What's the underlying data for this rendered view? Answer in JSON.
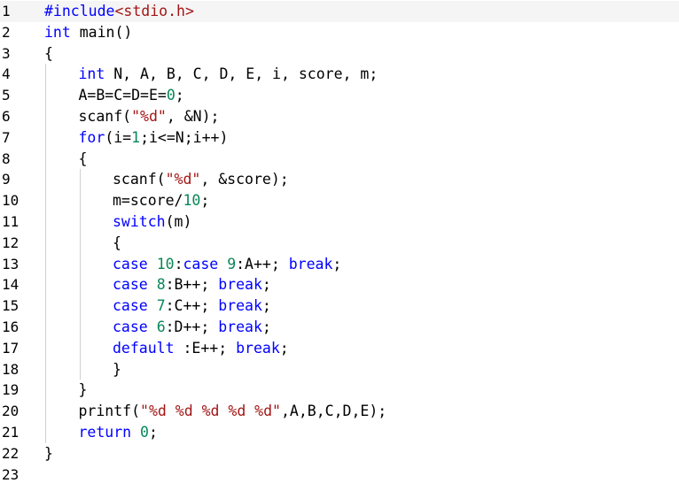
{
  "editor": {
    "lines": [
      {
        "num": "1",
        "indent": 0,
        "tokens": [
          {
            "t": "#include",
            "c": "pre"
          },
          {
            "t": "<stdio.h>",
            "c": "hdr"
          }
        ]
      },
      {
        "num": "2",
        "indent": 0,
        "tokens": [
          {
            "t": "int",
            "c": "kw"
          },
          {
            "t": " main()",
            "c": "txt"
          }
        ]
      },
      {
        "num": "3",
        "indent": 0,
        "tokens": [
          {
            "t": "{",
            "c": "txt"
          }
        ]
      },
      {
        "num": "4",
        "indent": 1,
        "tokens": [
          {
            "t": "int",
            "c": "kw"
          },
          {
            "t": " N, A, B, C, D, E, i, score, m;",
            "c": "txt"
          }
        ]
      },
      {
        "num": "5",
        "indent": 1,
        "tokens": [
          {
            "t": "A=B=C=D=E=",
            "c": "txt"
          },
          {
            "t": "0",
            "c": "num"
          },
          {
            "t": ";",
            "c": "txt"
          }
        ]
      },
      {
        "num": "6",
        "indent": 1,
        "tokens": [
          {
            "t": "scanf(",
            "c": "txt"
          },
          {
            "t": "\"%d\"",
            "c": "str"
          },
          {
            "t": ", &N);",
            "c": "txt"
          }
        ]
      },
      {
        "num": "7",
        "indent": 1,
        "tokens": [
          {
            "t": "for",
            "c": "kw"
          },
          {
            "t": "(i=",
            "c": "txt"
          },
          {
            "t": "1",
            "c": "num"
          },
          {
            "t": ";i<=N;i++)",
            "c": "txt"
          }
        ]
      },
      {
        "num": "8",
        "indent": 1,
        "tokens": [
          {
            "t": "{",
            "c": "txt"
          }
        ]
      },
      {
        "num": "9",
        "indent": 2,
        "tokens": [
          {
            "t": "scanf(",
            "c": "txt"
          },
          {
            "t": "\"%d\"",
            "c": "str"
          },
          {
            "t": ", &score);",
            "c": "txt"
          }
        ]
      },
      {
        "num": "10",
        "indent": 2,
        "tokens": [
          {
            "t": "m=score/",
            "c": "txt"
          },
          {
            "t": "10",
            "c": "num"
          },
          {
            "t": ";",
            "c": "txt"
          }
        ]
      },
      {
        "num": "11",
        "indent": 2,
        "tokens": [
          {
            "t": "switch",
            "c": "kw"
          },
          {
            "t": "(m)",
            "c": "txt"
          }
        ]
      },
      {
        "num": "12",
        "indent": 2,
        "tokens": [
          {
            "t": "{",
            "c": "txt"
          }
        ]
      },
      {
        "num": "13",
        "indent": 2,
        "tokens": [
          {
            "t": "case",
            "c": "kw"
          },
          {
            "t": " ",
            "c": "txt"
          },
          {
            "t": "10",
            "c": "num"
          },
          {
            "t": ":",
            "c": "txt"
          },
          {
            "t": "case",
            "c": "kw"
          },
          {
            "t": " ",
            "c": "txt"
          },
          {
            "t": "9",
            "c": "num"
          },
          {
            "t": ":A++; ",
            "c": "txt"
          },
          {
            "t": "break",
            "c": "kw"
          },
          {
            "t": ";",
            "c": "txt"
          }
        ]
      },
      {
        "num": "14",
        "indent": 2,
        "tokens": [
          {
            "t": "case",
            "c": "kw"
          },
          {
            "t": " ",
            "c": "txt"
          },
          {
            "t": "8",
            "c": "num"
          },
          {
            "t": ":B++; ",
            "c": "txt"
          },
          {
            "t": "break",
            "c": "kw"
          },
          {
            "t": ";",
            "c": "txt"
          }
        ]
      },
      {
        "num": "15",
        "indent": 2,
        "tokens": [
          {
            "t": "case",
            "c": "kw"
          },
          {
            "t": " ",
            "c": "txt"
          },
          {
            "t": "7",
            "c": "num"
          },
          {
            "t": ":C++; ",
            "c": "txt"
          },
          {
            "t": "break",
            "c": "kw"
          },
          {
            "t": ";",
            "c": "txt"
          }
        ]
      },
      {
        "num": "16",
        "indent": 2,
        "tokens": [
          {
            "t": "case",
            "c": "kw"
          },
          {
            "t": " ",
            "c": "txt"
          },
          {
            "t": "6",
            "c": "num"
          },
          {
            "t": ":D++; ",
            "c": "txt"
          },
          {
            "t": "break",
            "c": "kw"
          },
          {
            "t": ";",
            "c": "txt"
          }
        ]
      },
      {
        "num": "17",
        "indent": 2,
        "tokens": [
          {
            "t": "default",
            "c": "kw"
          },
          {
            "t": " :E++; ",
            "c": "txt"
          },
          {
            "t": "break",
            "c": "kw"
          },
          {
            "t": ";",
            "c": "txt"
          }
        ]
      },
      {
        "num": "18",
        "indent": 2,
        "tokens": [
          {
            "t": "}",
            "c": "txt"
          }
        ]
      },
      {
        "num": "19",
        "indent": 1,
        "tokens": [
          {
            "t": "}",
            "c": "txt"
          }
        ]
      },
      {
        "num": "20",
        "indent": 1,
        "tokens": [
          {
            "t": "printf(",
            "c": "txt"
          },
          {
            "t": "\"%d %d %d %d %d\"",
            "c": "str"
          },
          {
            "t": ",A,B,C,D,E);",
            "c": "txt"
          }
        ]
      },
      {
        "num": "21",
        "indent": 1,
        "tokens": [
          {
            "t": "return",
            "c": "kw"
          },
          {
            "t": " ",
            "c": "txt"
          },
          {
            "t": "0",
            "c": "num"
          },
          {
            "t": ";",
            "c": "txt"
          }
        ]
      },
      {
        "num": "22",
        "indent": 0,
        "tokens": [
          {
            "t": "}",
            "c": "txt"
          }
        ]
      },
      {
        "num": "23",
        "indent": 0,
        "tokens": []
      }
    ],
    "colors": {
      "keyword": "#0000ff",
      "string": "#a31515",
      "number": "#098658",
      "text": "#000000",
      "background": "#ffffff",
      "indent_guide": "#d0d0d0"
    }
  }
}
